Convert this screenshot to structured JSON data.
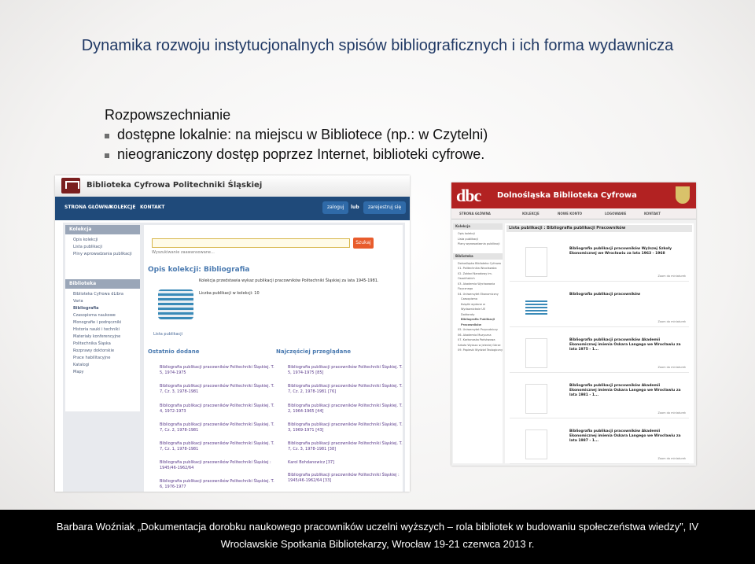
{
  "slide": {
    "title": "Dynamika rozwoju instytucjonalnych spisów bibliograficznych i ich forma wydawnicza",
    "subtitle": "Rozpowszechnianie",
    "bullets": [
      "dostępne lokalnie: na miejscu w Bibliotece (np.: w Czytelni)",
      "nieograniczony dostęp poprzez Internet, biblioteki cyfrowe."
    ],
    "footer_line1": "Barbara Woźniak „Dokumentacja dorobku naukowego pracowników uczelni wyższych – rola bibliotek w budowaniu społeczeństwa wiedzy”, IV",
    "footer_line2": "Wrocławskie Spotkania Bibliotekarzy, Wrocław 19-21 czerwca 2013 r."
  },
  "left_site": {
    "title": "Biblioteka Cyfrowa Politechniki Śląskiej",
    "nav": [
      "STRONA GŁÓWNA",
      "KOLEKCJE",
      "KONTAKT"
    ],
    "login_button": "zaloguj",
    "or": "lub",
    "register_button": "zarejestruj się",
    "search_button": "Szukaj",
    "search_advanced": "Wyszukiwanie zaawansowane...",
    "side1_header": "Kolekcja",
    "side1_items": [
      "Opis kolekcji",
      "Lista publikacji",
      "Pliny wprowadzania publikacji"
    ],
    "side2_header": "Biblioteka",
    "side2_items": [
      "Biblioteka Cyfrowa dLibra",
      "Varia",
      "Bibliografia",
      "Czasopisma naukowe",
      "Monografie i podręczniki",
      "Historia nauki i techniki",
      "Materiały konferencyjne",
      "Politechnika Śląska",
      "Rozprawy doktorskie",
      "Prace habilitacyjne",
      "Katalogi",
      "Mapy"
    ],
    "collection_title": "Opis kolekcji: Bibliografia",
    "collection_desc": "Kolekcja przedstawia wykaz publikacji pracowników Politechniki Śląskiej za lata 1945-1981.",
    "collection_count": "Liczba publikacji w kolekcji: 10",
    "list_link": "Lista publikacji",
    "recent_header": "Ostatnio dodane",
    "popular_header": "Najczęściej przeglądane",
    "recent": [
      "Bibliografia publikacji pracowników Politechniki Śląskiej. T. 5, 1974-1975",
      "Bibliografia publikacji pracowników Politechniki Śląskiej. T. 7, Cz. 3, 1978-1981",
      "Bibliografia publikacji pracowników Politechniki Śląskiej. T. 4, 1972-1973",
      "Bibliografia publikacji pracowników Politechniki Śląskiej. T. 7, Cz. 2, 1978-1981",
      "Bibliografia publikacji pracowników Politechniki Śląskiej. T. 7, Cz. 1, 1978-1981",
      "Bibliografia publikacji pracowników Politechniki Śląskiej : 1945/46-1962/64",
      "Bibliografia publikacji pracowników Politechniki Śląskiej. T. 6, 1976-1977"
    ],
    "popular": [
      "Bibliografia publikacji pracowników Politechniki Śląskiej. T. 5, 1974-1975 [85]",
      "Bibliografia publikacji pracowników Politechniki Śląskiej. T. 7, Cz. 2, 1978-1981 [76]",
      "Bibliografia publikacji pracowników Politechniki Śląskiej. T. 2, 1964-1965 [44]",
      "Bibliografia publikacji pracowników Politechniki Śląskiej. T. 3, 1969-1971 [43]",
      "Bibliografia publikacji pracowników Politechniki Śląskiej. T. 7, Cz. 3, 1978-1981 [38]",
      "Karol Bohdanowicz [37]",
      "Bibliografia publikacji pracowników Politechniki Śląskiej : 1945/46-1962/64 [33]"
    ]
  },
  "right_site": {
    "logo": "dbc",
    "title": "Dolnośląska Biblioteka Cyfrowa",
    "nav": [
      "STRONA GŁÓWNA",
      "KOLEKCJE",
      "NOWE KONTO",
      "LOGOWANIE",
      "KONTAKT"
    ],
    "side1_header": "Kolekcja",
    "side1_items": [
      "Opis kolekcji",
      "Lista publikacji",
      "Plany wprowadzania publikacji"
    ],
    "side2_header": "Biblioteka",
    "side2_items": [
      "Dolnośląska Biblioteka Cyfrowa",
      "01. Politechnika Wrocławska",
      "02. Zakład Narodowy im. Ossolińskich",
      "03. Akademia Wychowania Fizycznego",
      "04. Uniwersytet Ekonomiczny",
      "Czasopisma",
      "Książki wydane w Wydawnictwie UE",
      "Doktoraty",
      "Bibliografia Publikacji Pracowników",
      "05. Uniwersytet Przyrodniczy",
      "06. Akademia Muzyczna",
      "07. Karkonoska Państwowa Szkoła Wyższa w Jeleniej Górze",
      "09. Papieski Wydział Teologiczny"
    ],
    "list_title": "Lista publikacji : Bibliografia publikacji Pracowników",
    "zoom_label": "Zoom do miniaturek",
    "items": [
      "Bibliografia publikacji pracowników Wyższej Szkoły Ekonomicznej we Wrocławiu za lata 1963 - 1968",
      "Bibliografia publikacji pracowników",
      "Bibliografia publikacji pracowników Akademii Ekonomicznej imienia Oskara Langego we Wrocławiu za lata 1975 - 1...",
      "Bibliografia publikacji pracowników Akademii Ekonomicznej imienia Oskara Langego we Wrocławiu za lata 1981 - 1...",
      "Bibliografia publikacji pracowników Akademii Ekonomicznej imienia Oskara Langego we Wrocławiu za lata 1987 - 1..."
    ]
  }
}
